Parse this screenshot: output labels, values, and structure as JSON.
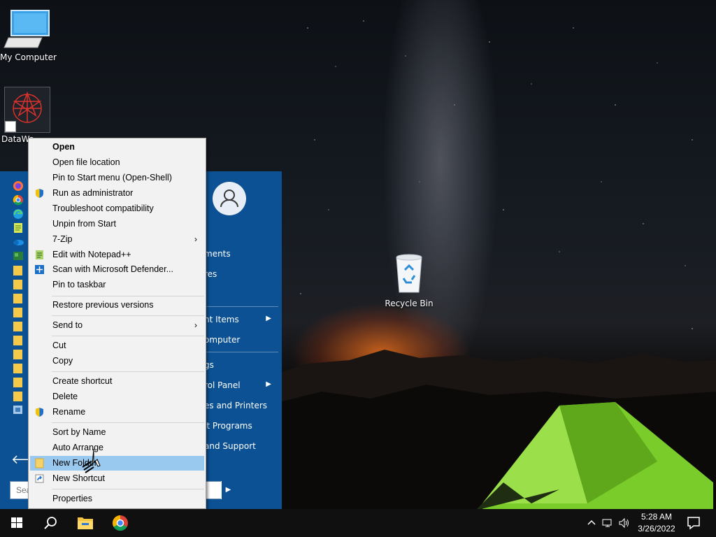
{
  "desktop": {
    "icons": [
      {
        "label": "My Computer",
        "icon": "computer-icon"
      },
      {
        "label": "DataWa",
        "icon": "datawarrior-shortcut-icon"
      },
      {
        "label": "Recycle Bin",
        "icon": "recycle-bin-icon"
      }
    ]
  },
  "start_menu": {
    "right_items": [
      {
        "label": "ments"
      },
      {
        "label": "res"
      },
      {
        "label": "nt Items",
        "submenu": true
      },
      {
        "label": "omputer"
      },
      {
        "label": "gs"
      },
      {
        "label": "rol Panel",
        "submenu": true
      },
      {
        "label": "es and Printers"
      },
      {
        "label": "lt Programs"
      },
      {
        "label": "and Support"
      }
    ],
    "search": {
      "placeholder": "Sea"
    }
  },
  "context_menu": {
    "items": [
      {
        "label": "Open",
        "bold": true
      },
      {
        "label": "Open file location"
      },
      {
        "label": "Pin to Start menu (Open-Shell)"
      },
      {
        "label": "Run as administrator",
        "icon": "uac-shield-icon"
      },
      {
        "label": "Troubleshoot compatibility"
      },
      {
        "label": "Unpin from Start"
      },
      {
        "label": "7-Zip",
        "submenu": true
      },
      {
        "label": "Edit with Notepad++",
        "icon": "notepadpp-icon"
      },
      {
        "label": "Scan with Microsoft Defender...",
        "icon": "defender-icon"
      },
      {
        "label": "Pin to taskbar"
      },
      {
        "label": "Restore previous versions"
      },
      {
        "label": "Send to",
        "submenu": true
      },
      {
        "label": "Cut"
      },
      {
        "label": "Copy"
      },
      {
        "label": "Create shortcut"
      },
      {
        "label": "Delete"
      },
      {
        "label": "Rename",
        "icon": "uac-shield-icon"
      },
      {
        "label": "Sort by Name"
      },
      {
        "label": "Auto Arrange"
      },
      {
        "label": "New Folder",
        "icon": "folder-icon",
        "highlighted": true
      },
      {
        "label": "New Shortcut",
        "icon": "shortcut-icon"
      },
      {
        "label": "Properties"
      }
    ],
    "submenu_glyph": "›"
  },
  "taskbar": {
    "clock": {
      "time": "5:28 AM",
      "date": "3/26/2022"
    }
  },
  "colors": {
    "start_menu_bg": "#0c5193",
    "menu_highlight": "#99c9ef",
    "taskbar_bg": "#101010"
  }
}
